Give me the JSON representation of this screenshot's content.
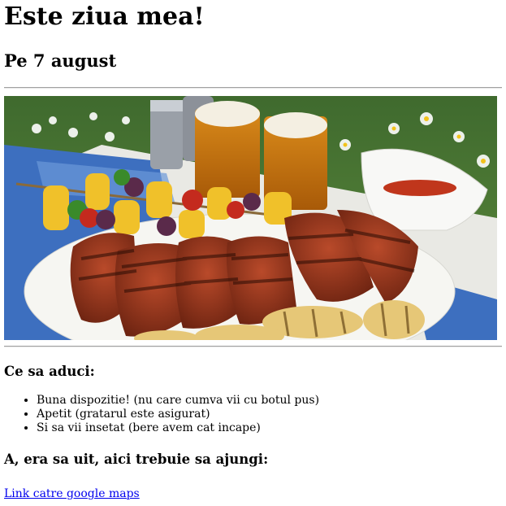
{
  "title": "Este ziua mea!",
  "date": "Pe 7 august",
  "image": {
    "icon": "bbq-photo"
  },
  "bring": {
    "heading": "Ce sa aduci:",
    "items": [
      "Buna dispozitie! (nu care cumva vii cu botul pus)",
      "Apetit (gratarul este asigurat)",
      "Si sa vii insetat (bere avem cat incape)"
    ]
  },
  "location": {
    "heading": "A, era sa uit, aici trebuie sa ajungi:",
    "link_text": "Link catre google maps"
  }
}
